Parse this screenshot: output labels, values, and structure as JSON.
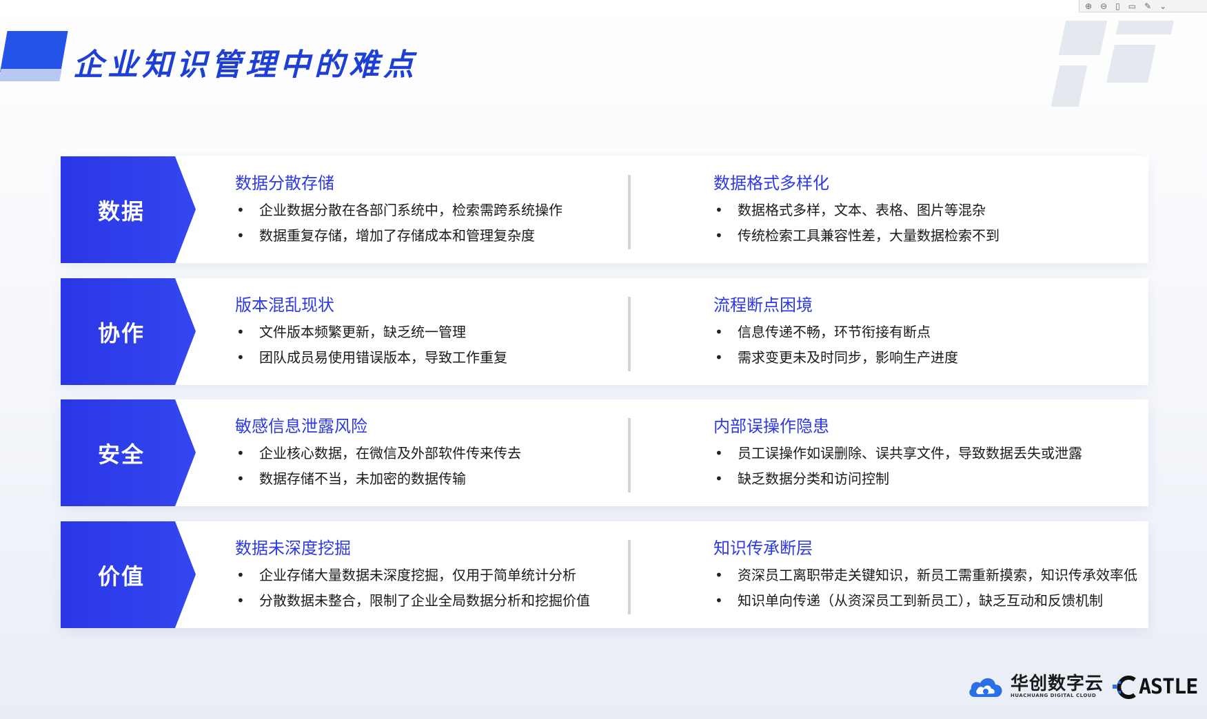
{
  "toolbar": {
    "icons": [
      "zoom-in-icon",
      "zoom-out-icon",
      "page-icon",
      "page-down-icon",
      "pen-icon",
      "chevron-down-icon"
    ]
  },
  "title": "企业知识管理中的难点",
  "rows": [
    {
      "category": "数据",
      "left": {
        "heading": "数据分散存储",
        "items": [
          "企业数据分散在各部门系统中，检索需跨系统操作",
          "数据重复存储，增加了存储成本和管理复杂度"
        ]
      },
      "right": {
        "heading": "数据格式多样化",
        "items": [
          "数据格式多样，文本、表格、图片等混杂",
          "传统检索工具兼容性差，大量数据检索不到"
        ]
      }
    },
    {
      "category": "协作",
      "left": {
        "heading": "版本混乱现状",
        "items": [
          "文件版本频繁更新，缺乏统一管理",
          "团队成员易使用错误版本，导致工作重复"
        ]
      },
      "right": {
        "heading": "流程断点困境",
        "items": [
          "信息传递不畅，环节衔接有断点",
          "需求变更未及时同步，影响生产进度"
        ]
      }
    },
    {
      "category": "安全",
      "left": {
        "heading": "敏感信息泄露风险",
        "items": [
          "企业核心数据，在微信及外部软件传来传去",
          "数据存储不当，未加密的数据传输"
        ]
      },
      "right": {
        "heading": "内部误操作隐患",
        "items": [
          "员工误操作如误删除、误共享文件，导致数据丢失或泄露",
          "缺乏数据分类和访问控制"
        ]
      }
    },
    {
      "category": "价值",
      "left": {
        "heading": "数据未深度挖掘",
        "items": [
          "企业存储大量数据未深度挖掘，仅用于简单统计分析",
          "分散数据未整合，限制了企业全局数据分析和挖掘价值"
        ]
      },
      "right": {
        "heading": "知识传承断层",
        "items": [
          "资深员工离职带走关键知识，新员工需重新摸索，知识传承效率低",
          "知识单向传递（从资深员工到新员工），缺乏互动和反馈机制"
        ]
      }
    }
  ],
  "footer": {
    "logo_cn": "华创数字云",
    "logo_en": "HUACHUANG DIGITAL CLOUD",
    "astle": "ASTLE"
  },
  "colors": {
    "accent": "#2d39e6",
    "title": "#1d3fd6"
  }
}
